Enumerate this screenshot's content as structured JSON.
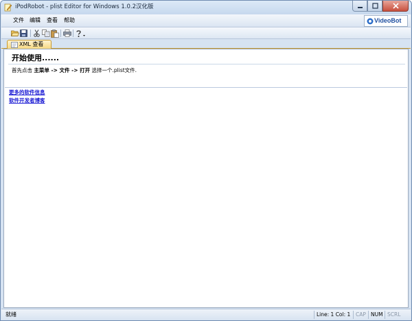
{
  "window": {
    "title": "iPodRobot - plist Editor for Windows 1.0.2汉化版"
  },
  "menu": [
    "文件",
    "编辑",
    "查看",
    "帮助"
  ],
  "brand": {
    "text": "VideoBot"
  },
  "toolbar": {
    "buttons": [
      "open-folder-icon",
      "save-icon",
      "cut-icon",
      "copy-icon",
      "paste-icon",
      "print-icon",
      "help-icon"
    ]
  },
  "tabs": [
    {
      "label": "XML 查看"
    }
  ],
  "start": {
    "title": "开始使用......",
    "prefix": "首先点击 ",
    "step1": "主菜单",
    "arrow1": " -> ",
    "step2": "文件",
    "arrow2": " -> ",
    "step3": "打开",
    "suffix": " 选择一个.plist文件."
  },
  "links": [
    "更多的软件信息",
    "软件开发者博客"
  ],
  "status": {
    "left": "就绪",
    "position": "Line: 1 Col: 1",
    "cap": "CAP",
    "num": "NUM",
    "scrl": "SCRL"
  },
  "colors": {
    "link": "#1a1ad4",
    "tab_active": "#f7d982",
    "chrome": "#d6e3f2"
  }
}
